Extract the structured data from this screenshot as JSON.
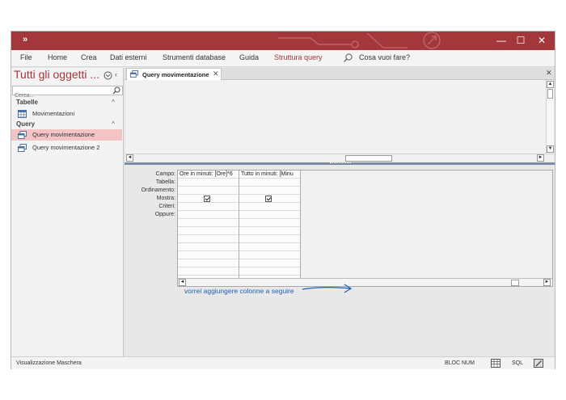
{
  "app": {
    "qat_label": "»"
  },
  "window_controls": {
    "minimize": "—",
    "restore": "☐",
    "close": "✕"
  },
  "menu": {
    "items": [
      "File",
      "Home",
      "Crea",
      "Dati esterni",
      "Strumenti database",
      "Guida",
      "Struttura query"
    ],
    "active_index": 6,
    "tell_me": "Cosa vuoi fare?"
  },
  "nav_pane": {
    "title": "Tutti gli oggetti ...",
    "close_glyph": "‹",
    "search_placeholder": "Cerca...",
    "groups": [
      {
        "label": "Tabelle",
        "chevron": "^",
        "items": [
          {
            "label": "Movimentazioni",
            "icon": "table-icon",
            "selected": false
          }
        ]
      },
      {
        "label": "Query",
        "chevron": "^",
        "items": [
          {
            "label": "Query movimentazione",
            "icon": "query-icon",
            "selected": true
          },
          {
            "label": "Query movimentazione 2",
            "icon": "query-icon",
            "selected": false
          }
        ]
      }
    ]
  },
  "document": {
    "tab_label": "Query movimentazione",
    "tab_close": "✕",
    "doc_close": "✕"
  },
  "design_grid": {
    "row_labels": [
      "Campo:",
      "Tabella:",
      "Ordinamento:",
      "Mostra:",
      "Criteri:",
      "Oppure:"
    ],
    "columns": [
      {
        "field": "Ore in minuti: [Ore]*6",
        "show": true
      },
      {
        "field": "Tutto in minuti: [Minu",
        "show": true
      }
    ]
  },
  "annotation": {
    "text": "vorrei aggiungere colonne a seguire",
    "color": "#1f5fb4"
  },
  "status": {
    "left": "Visualizzazione Maschera",
    "num_lock": "BLOC NUM",
    "sql": "SQL"
  },
  "colors": {
    "accent": "#a4373a",
    "selection": "#f4c3c4"
  }
}
